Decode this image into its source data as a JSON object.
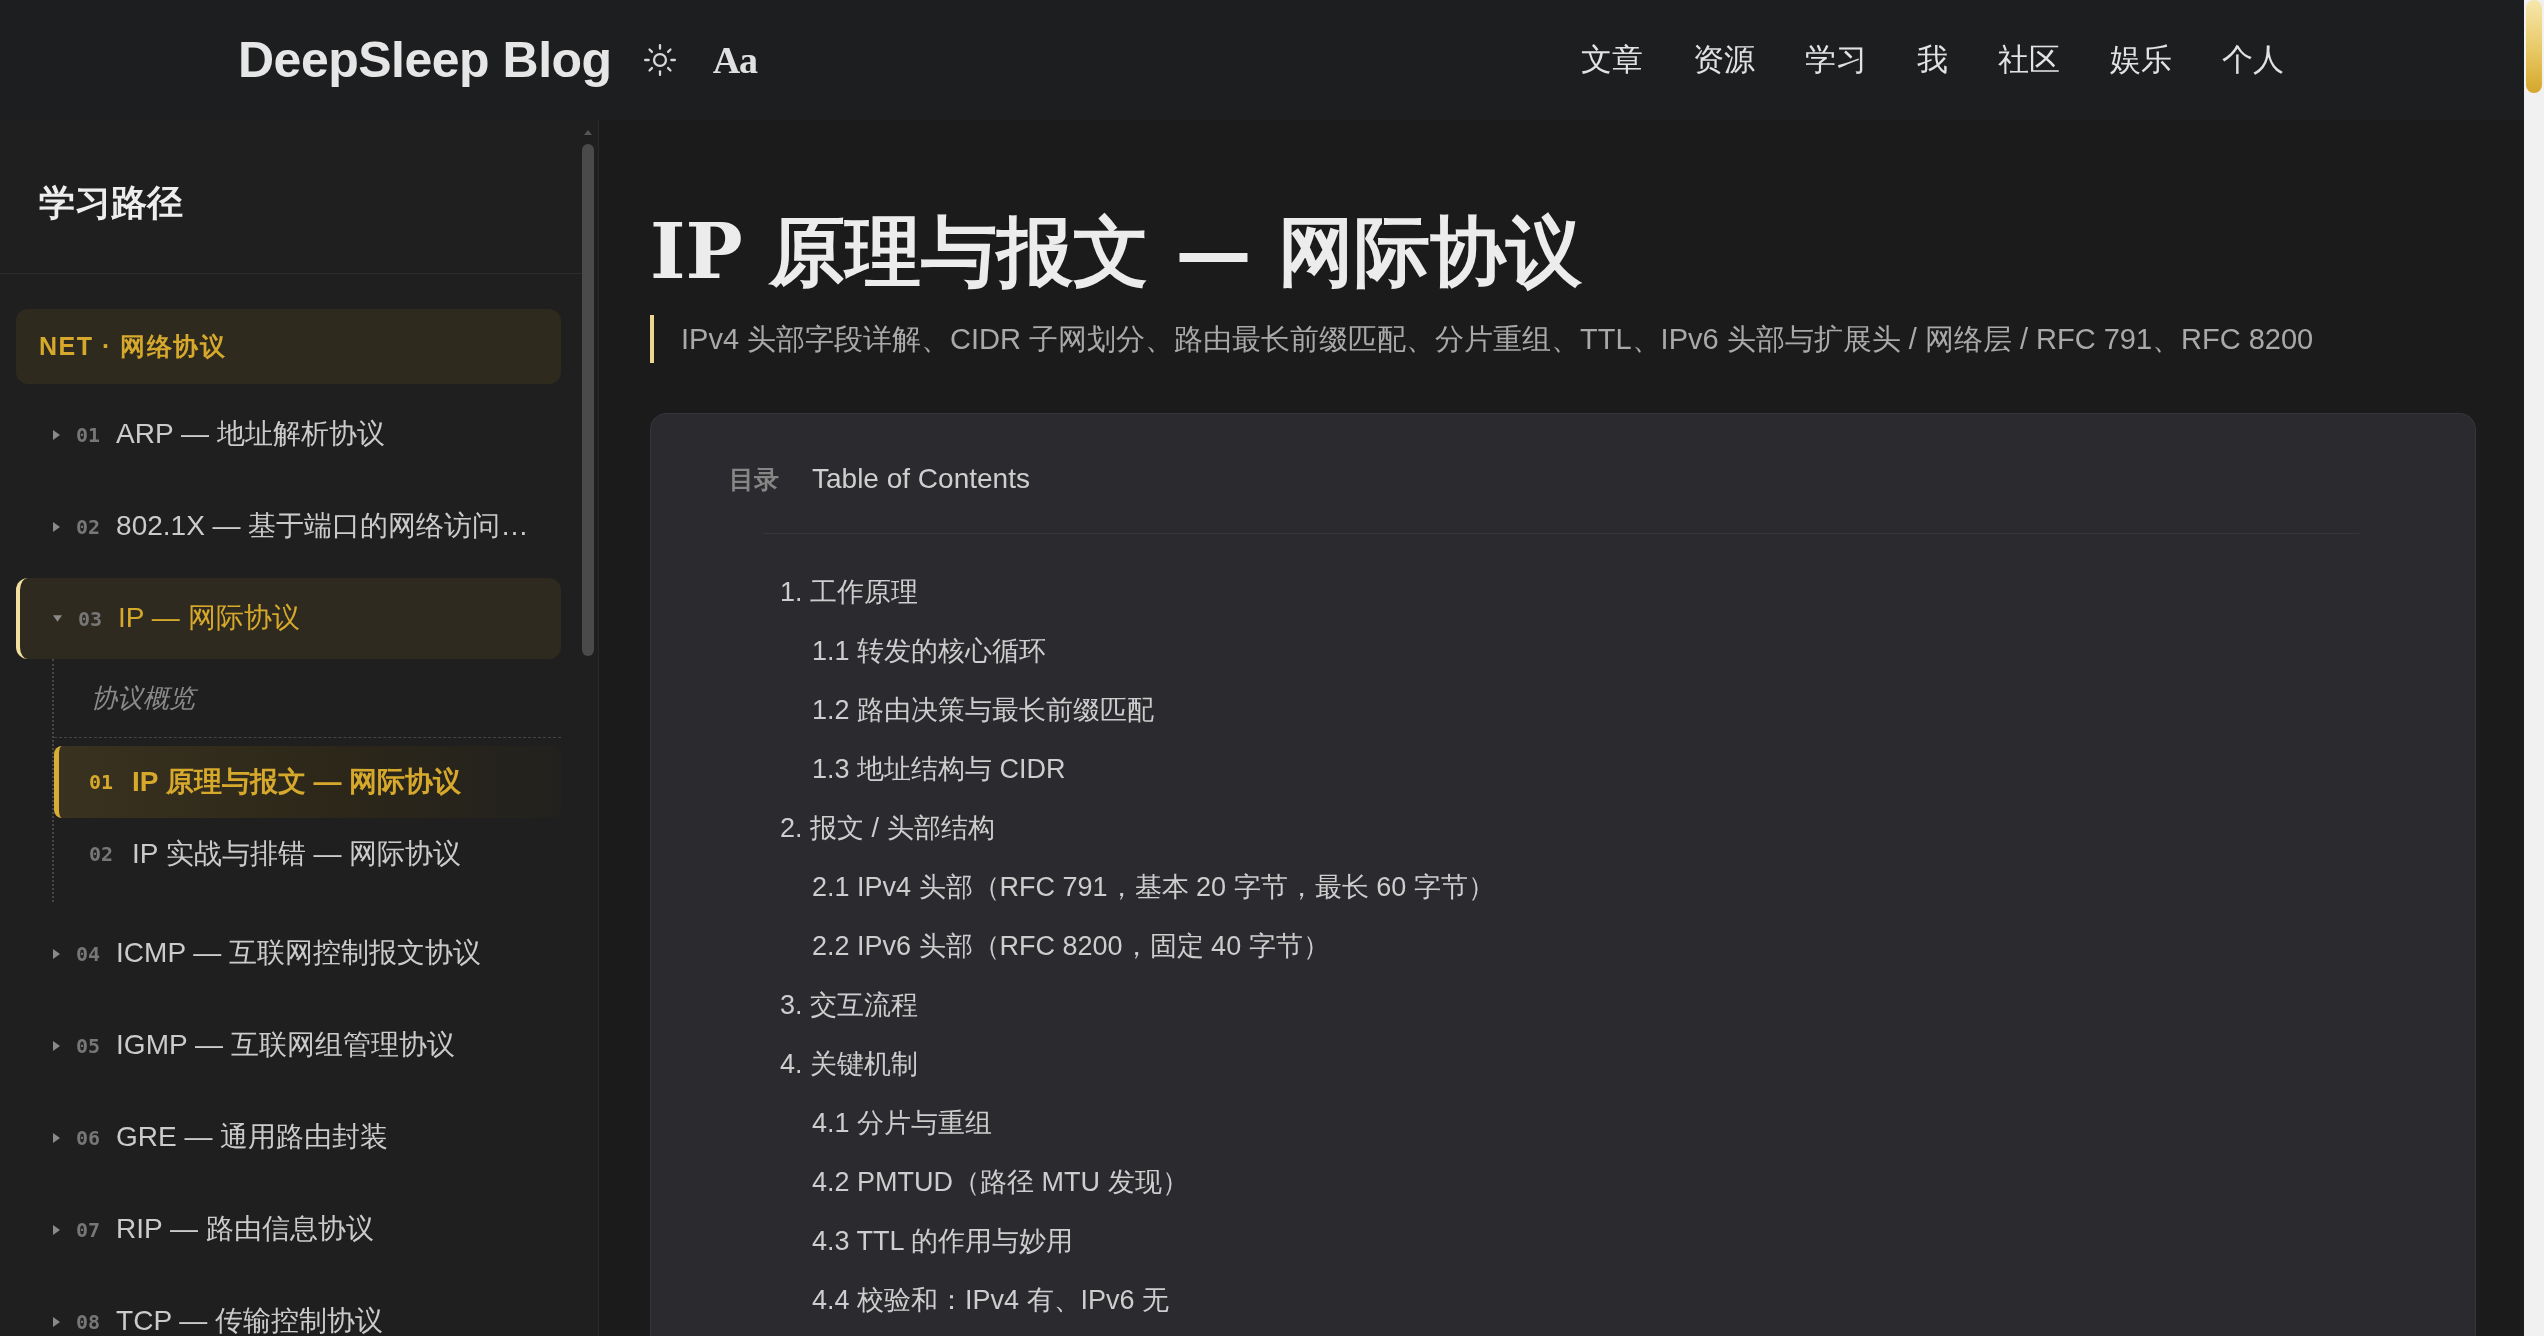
{
  "header": {
    "logo": "DeepSleep Blog",
    "font_button": "Aa",
    "nav": [
      "文章",
      "资源",
      "学习",
      "我",
      "社区",
      "娱乐",
      "个人"
    ]
  },
  "sidebar": {
    "title": "学习路径",
    "group": "NET · 网络协议",
    "items": [
      {
        "number": "01",
        "label": "ARP — 地址解析协议",
        "expanded": false
      },
      {
        "number": "02",
        "label": "802.1X — 基于端口的网络访问…",
        "expanded": false
      },
      {
        "number": "03",
        "label": "IP — 网际协议",
        "expanded": true,
        "section_label": "协议概览",
        "children": [
          {
            "number": "01",
            "label": "IP 原理与报文 — 网际协议",
            "selected": true
          },
          {
            "number": "02",
            "label": "IP 实战与排错 — 网际协议",
            "selected": false
          }
        ]
      },
      {
        "number": "04",
        "label": "ICMP — 互联网控制报文协议",
        "expanded": false
      },
      {
        "number": "05",
        "label": "IGMP — 互联网组管理协议",
        "expanded": false
      },
      {
        "number": "06",
        "label": "GRE — 通用路由封装",
        "expanded": false
      },
      {
        "number": "07",
        "label": "RIP — 路由信息协议",
        "expanded": false
      },
      {
        "number": "08",
        "label": "TCP — 传输控制协议",
        "expanded": false
      }
    ]
  },
  "article": {
    "title": "IP 原理与报文 — 网际协议",
    "subtitle": "IPv4 头部字段详解、CIDR 子网划分、路由最长前缀匹配、分片重组、TTL、IPv6 头部与扩展头 / 网络层 / RFC 791、RFC 8200",
    "toc": {
      "label": "目录",
      "title": "Table of Contents",
      "items": [
        {
          "text": "1. 工作原理",
          "children": [
            {
              "text": "1.1 转发的核心循环"
            },
            {
              "text": "1.2 路由决策与最长前缀匹配"
            },
            {
              "text": "1.3 地址结构与 CIDR"
            }
          ]
        },
        {
          "text": "2. 报文 / 头部结构",
          "children": [
            {
              "text": "2.1 IPv4 头部（RFC 791，基本 20 字节，最长 60 字节）"
            },
            {
              "text": "2.2 IPv6 头部（RFC 8200，固定 40 字节）"
            }
          ]
        },
        {
          "text": "3. 交互流程"
        },
        {
          "text": "4. 关键机制",
          "children": [
            {
              "text": "4.1 分片与重组"
            },
            {
              "text": "4.2 PMTUD（路径 MTU 发现）"
            },
            {
              "text": "4.3 TTL 的作用与妙用"
            },
            {
              "text": "4.4 校验和：IPv4 有、IPv6 无"
            }
          ]
        }
      ]
    }
  }
}
